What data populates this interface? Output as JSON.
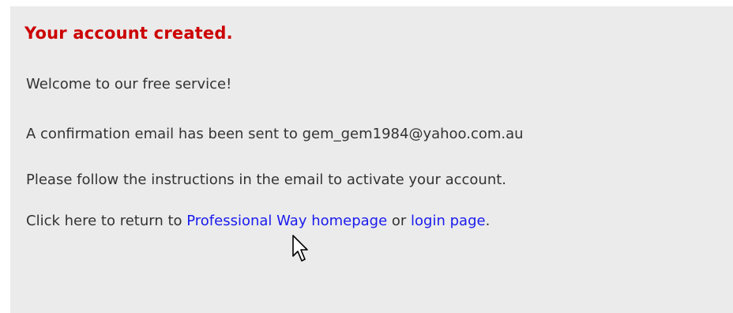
{
  "page": {
    "title": "Your account created.",
    "welcome": "Welcome to our free service!",
    "confirmation": "A confirmation email has been sent to gem_gem1984@yahoo.com.au",
    "instructions": "Please follow the instructions in the email to activate your account.",
    "return_prefix": "Click here to return to ",
    "homepage_link": "Professional Way homepage",
    "connector": " or ",
    "login_link": "login page",
    "suffix": "."
  },
  "colors": {
    "title": "#cc0000",
    "text": "#333333",
    "link": "#1a1aee",
    "panel_bg": "#ebebeb"
  },
  "icons": {
    "cursor": "mouse-pointer-icon"
  }
}
